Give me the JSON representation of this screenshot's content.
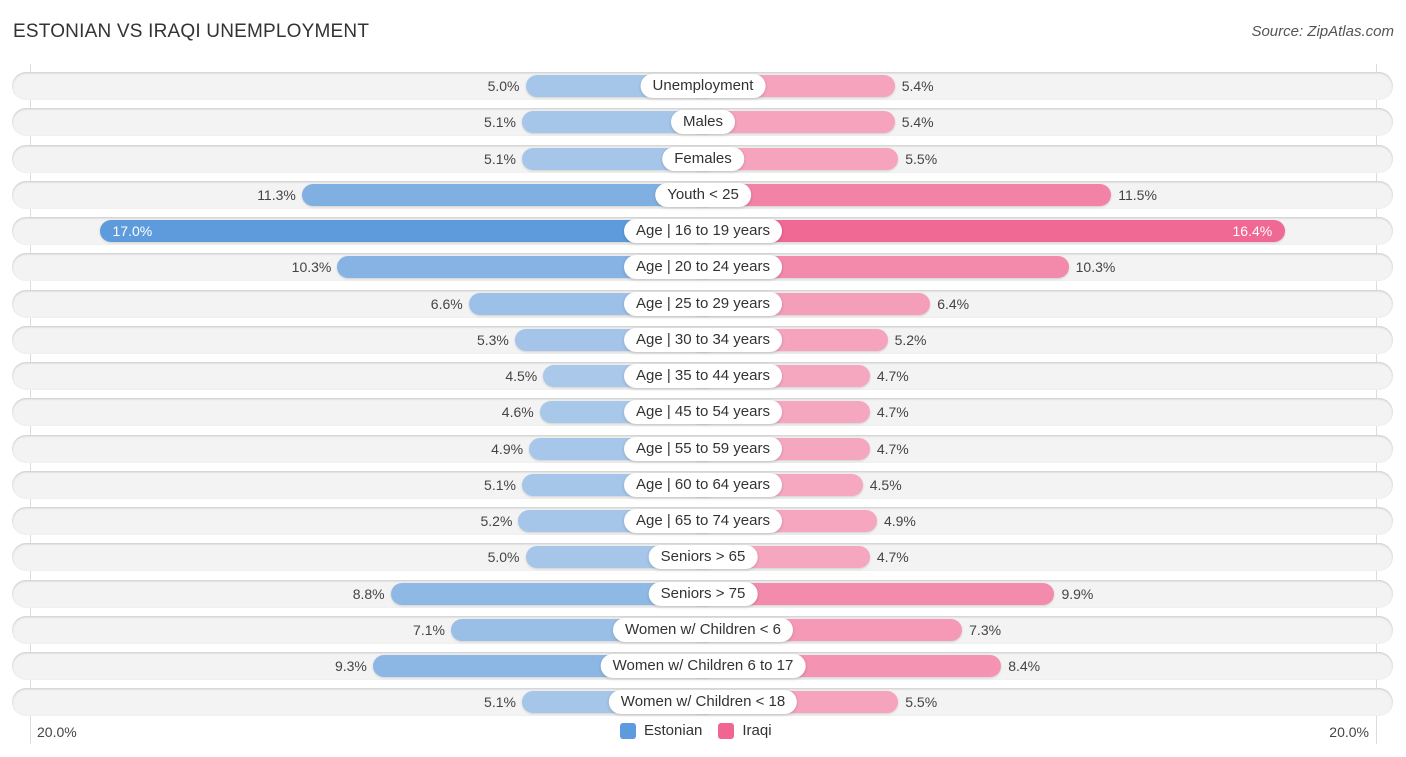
{
  "header": {
    "title": "ESTONIAN VS IRAQI UNEMPLOYMENT",
    "source": "Source: ZipAtlas.com"
  },
  "colors": {
    "estonian_light": "#a9c8ea",
    "estonian_dark": "#5e9bdc",
    "iraqi_light": "#f6a8c1",
    "iraqi_dark": "#f06592"
  },
  "chart_data": {
    "type": "bar",
    "orientation": "horizontal-diverging",
    "title": "ESTONIAN VS IRAQI UNEMPLOYMENT",
    "categories": [
      "Unemployment",
      "Males",
      "Females",
      "Youth < 25",
      "Age | 16 to 19 years",
      "Age | 20 to 24 years",
      "Age | 25 to 29 years",
      "Age | 30 to 34 years",
      "Age | 35 to 44 years",
      "Age | 45 to 54 years",
      "Age | 55 to 59 years",
      "Age | 60 to 64 years",
      "Age | 65 to 74 years",
      "Seniors > 65",
      "Seniors > 75",
      "Women w/ Children < 6",
      "Women w/ Children 6 to 17",
      "Women w/ Children < 18"
    ],
    "series": [
      {
        "name": "Estonian",
        "side": "left",
        "values": [
          5.0,
          5.1,
          5.1,
          11.3,
          17.0,
          10.3,
          6.6,
          5.3,
          4.5,
          4.6,
          4.9,
          5.1,
          5.2,
          5.0,
          8.8,
          7.1,
          9.3,
          5.1
        ],
        "labels": [
          "5.0%",
          "5.1%",
          "5.1%",
          "11.3%",
          "17.0%",
          "10.3%",
          "6.6%",
          "5.3%",
          "4.5%",
          "4.6%",
          "4.9%",
          "5.1%",
          "5.2%",
          "5.0%",
          "8.8%",
          "7.1%",
          "9.3%",
          "5.1%"
        ]
      },
      {
        "name": "Iraqi",
        "side": "right",
        "values": [
          5.4,
          5.4,
          5.5,
          11.5,
          16.4,
          10.3,
          6.4,
          5.2,
          4.7,
          4.7,
          4.7,
          4.5,
          4.9,
          4.7,
          9.9,
          7.3,
          8.4,
          5.5
        ],
        "labels": [
          "5.4%",
          "5.4%",
          "5.5%",
          "11.5%",
          "16.4%",
          "10.3%",
          "6.4%",
          "5.2%",
          "4.7%",
          "4.7%",
          "4.7%",
          "4.5%",
          "4.9%",
          "4.7%",
          "9.9%",
          "7.3%",
          "8.4%",
          "5.5%"
        ]
      }
    ],
    "xlim": [
      -20.0,
      20.0
    ],
    "axis_labels": {
      "left": "20.0%",
      "right": "20.0%"
    },
    "legend": {
      "position": "bottom-center",
      "entries": [
        "Estonian",
        "Iraqi"
      ]
    },
    "units": "%"
  }
}
